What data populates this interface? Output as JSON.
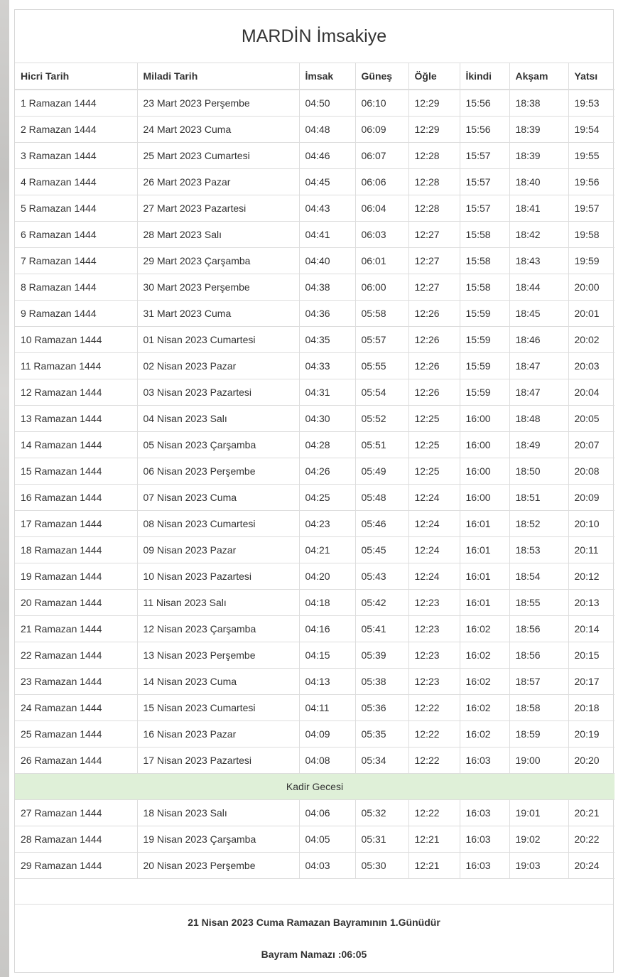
{
  "page": {
    "title": "MARDİN İmsakiye"
  },
  "colors": {
    "kadir_row_background": "#dff0d8",
    "table_border": "#dddddd",
    "text": "#333333"
  },
  "table": {
    "headers": [
      "Hicri Tarih",
      "Miladi Tarih",
      "İmsak",
      "Güneş",
      "Öğle",
      "İkindi",
      "Akşam",
      "Yatsı"
    ],
    "kadir_row": {
      "label": "Kadir Gecesi",
      "before_row_index": 26
    },
    "rows": [
      [
        "1 Ramazan 1444",
        "23 Mart 2023 Perşembe",
        "04:50",
        "06:10",
        "12:29",
        "15:56",
        "18:38",
        "19:53"
      ],
      [
        "2 Ramazan 1444",
        "24 Mart 2023 Cuma",
        "04:48",
        "06:09",
        "12:29",
        "15:56",
        "18:39",
        "19:54"
      ],
      [
        "3 Ramazan 1444",
        "25 Mart 2023 Cumartesi",
        "04:46",
        "06:07",
        "12:28",
        "15:57",
        "18:39",
        "19:55"
      ],
      [
        "4 Ramazan 1444",
        "26 Mart 2023 Pazar",
        "04:45",
        "06:06",
        "12:28",
        "15:57",
        "18:40",
        "19:56"
      ],
      [
        "5 Ramazan 1444",
        "27 Mart 2023 Pazartesi",
        "04:43",
        "06:04",
        "12:28",
        "15:57",
        "18:41",
        "19:57"
      ],
      [
        "6 Ramazan 1444",
        "28 Mart 2023 Salı",
        "04:41",
        "06:03",
        "12:27",
        "15:58",
        "18:42",
        "19:58"
      ],
      [
        "7 Ramazan 1444",
        "29 Mart 2023 Çarşamba",
        "04:40",
        "06:01",
        "12:27",
        "15:58",
        "18:43",
        "19:59"
      ],
      [
        "8 Ramazan 1444",
        "30 Mart 2023 Perşembe",
        "04:38",
        "06:00",
        "12:27",
        "15:58",
        "18:44",
        "20:00"
      ],
      [
        "9 Ramazan 1444",
        "31 Mart 2023 Cuma",
        "04:36",
        "05:58",
        "12:26",
        "15:59",
        "18:45",
        "20:01"
      ],
      [
        "10 Ramazan 1444",
        "01 Nisan 2023 Cumartesi",
        "04:35",
        "05:57",
        "12:26",
        "15:59",
        "18:46",
        "20:02"
      ],
      [
        "11 Ramazan 1444",
        "02 Nisan 2023 Pazar",
        "04:33",
        "05:55",
        "12:26",
        "15:59",
        "18:47",
        "20:03"
      ],
      [
        "12 Ramazan 1444",
        "03 Nisan 2023 Pazartesi",
        "04:31",
        "05:54",
        "12:26",
        "15:59",
        "18:47",
        "20:04"
      ],
      [
        "13 Ramazan 1444",
        "04 Nisan 2023 Salı",
        "04:30",
        "05:52",
        "12:25",
        "16:00",
        "18:48",
        "20:05"
      ],
      [
        "14 Ramazan 1444",
        "05 Nisan 2023 Çarşamba",
        "04:28",
        "05:51",
        "12:25",
        "16:00",
        "18:49",
        "20:07"
      ],
      [
        "15 Ramazan 1444",
        "06 Nisan 2023 Perşembe",
        "04:26",
        "05:49",
        "12:25",
        "16:00",
        "18:50",
        "20:08"
      ],
      [
        "16 Ramazan 1444",
        "07 Nisan 2023 Cuma",
        "04:25",
        "05:48",
        "12:24",
        "16:00",
        "18:51",
        "20:09"
      ],
      [
        "17 Ramazan 1444",
        "08 Nisan 2023 Cumartesi",
        "04:23",
        "05:46",
        "12:24",
        "16:01",
        "18:52",
        "20:10"
      ],
      [
        "18 Ramazan 1444",
        "09 Nisan 2023 Pazar",
        "04:21",
        "05:45",
        "12:24",
        "16:01",
        "18:53",
        "20:11"
      ],
      [
        "19 Ramazan 1444",
        "10 Nisan 2023 Pazartesi",
        "04:20",
        "05:43",
        "12:24",
        "16:01",
        "18:54",
        "20:12"
      ],
      [
        "20 Ramazan 1444",
        "11 Nisan 2023 Salı",
        "04:18",
        "05:42",
        "12:23",
        "16:01",
        "18:55",
        "20:13"
      ],
      [
        "21 Ramazan 1444",
        "12 Nisan 2023 Çarşamba",
        "04:16",
        "05:41",
        "12:23",
        "16:02",
        "18:56",
        "20:14"
      ],
      [
        "22 Ramazan 1444",
        "13 Nisan 2023 Perşembe",
        "04:15",
        "05:39",
        "12:23",
        "16:02",
        "18:56",
        "20:15"
      ],
      [
        "23 Ramazan 1444",
        "14 Nisan 2023 Cuma",
        "04:13",
        "05:38",
        "12:23",
        "16:02",
        "18:57",
        "20:17"
      ],
      [
        "24 Ramazan 1444",
        "15 Nisan 2023 Cumartesi",
        "04:11",
        "05:36",
        "12:22",
        "16:02",
        "18:58",
        "20:18"
      ],
      [
        "25 Ramazan 1444",
        "16 Nisan 2023 Pazar",
        "04:09",
        "05:35",
        "12:22",
        "16:02",
        "18:59",
        "20:19"
      ],
      [
        "26 Ramazan 1444",
        "17 Nisan 2023 Pazartesi",
        "04:08",
        "05:34",
        "12:22",
        "16:03",
        "19:00",
        "20:20"
      ],
      [
        "27 Ramazan 1444",
        "18 Nisan 2023 Salı",
        "04:06",
        "05:32",
        "12:22",
        "16:03",
        "19:01",
        "20:21"
      ],
      [
        "28 Ramazan 1444",
        "19 Nisan 2023 Çarşamba",
        "04:05",
        "05:31",
        "12:21",
        "16:03",
        "19:02",
        "20:22"
      ],
      [
        "29 Ramazan 1444",
        "20 Nisan 2023 Perşembe",
        "04:03",
        "05:30",
        "12:21",
        "16:03",
        "19:03",
        "20:24"
      ]
    ]
  },
  "footer": {
    "line1": "21 Nisan 2023 Cuma Ramazan Bayramının 1.Günüdür",
    "line2": "Bayram Namazı :06:05"
  }
}
